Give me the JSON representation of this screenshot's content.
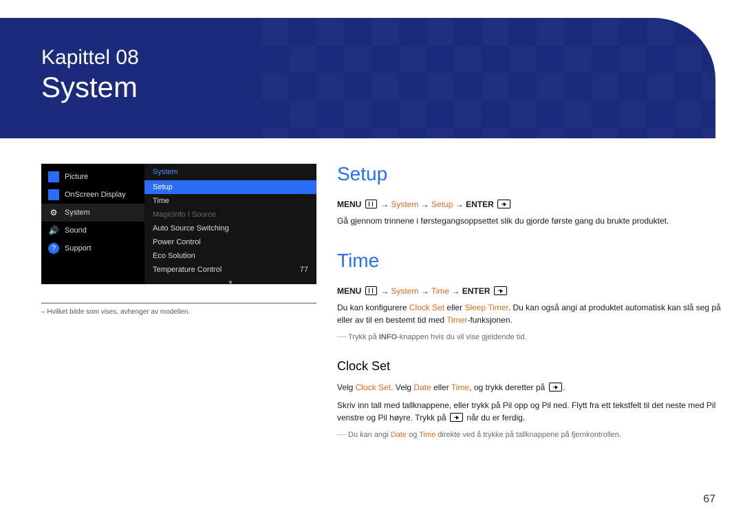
{
  "chapter": {
    "pre": "Kapittel 08",
    "title": "System"
  },
  "page_number": "67",
  "osd": {
    "left": [
      {
        "icon": "picture-icon",
        "label": "Picture"
      },
      {
        "icon": "onscreen-icon",
        "label": "OnScreen Display"
      },
      {
        "icon": "gear-icon",
        "label": "System"
      },
      {
        "icon": "speaker-icon",
        "label": "Sound"
      },
      {
        "icon": "help-icon",
        "label": "Support"
      }
    ],
    "right_header": "System",
    "right": [
      {
        "label": "Setup",
        "value": "",
        "state": "selected"
      },
      {
        "label": "Time",
        "value": ""
      },
      {
        "label": "MagicInfo I Source",
        "value": "",
        "state": "disabled"
      },
      {
        "label": "Auto Source Switching",
        "value": ""
      },
      {
        "label": "Power Control",
        "value": ""
      },
      {
        "label": "Eco Solution",
        "value": ""
      },
      {
        "label": "Temperature Control",
        "value": "77"
      }
    ],
    "footnote_prefix": "–",
    "footnote": "Hvilket bilde som vises, avhenger av modellen."
  },
  "setup": {
    "heading": "Setup",
    "path_menu": "MENU",
    "path_system": "System",
    "path_setup": "Setup",
    "path_enter": "ENTER",
    "body": "Gå gjennom trinnene i førstegangsoppsettet slik du gjorde første gang du brukte produktet."
  },
  "time": {
    "heading": "Time",
    "path_menu": "MENU",
    "path_system": "System",
    "path_time": "Time",
    "path_enter": "ENTER",
    "body_pre1": "Du kan konfigurere ",
    "body_clockset": "Clock Set",
    "body_mid1": " eller ",
    "body_sleeptimer": "Sleep Timer",
    "body_post1": ". Du kan også angi at produktet automatisk kan slå seg på eller av til en bestemt tid med ",
    "body_timer": "Timer",
    "body_post2": "-funksjonen.",
    "hint_pre": "Trykk på ",
    "hint_bold": "INFO",
    "hint_post": "-knappen hvis du vil vise gjeldende tid."
  },
  "clock_set": {
    "heading": "Clock Set",
    "l1_pre": "Velg ",
    "l1_clockset": "Clock Set",
    "l1_mid1": ". Velg ",
    "l1_date": "Date",
    "l1_mid2": " eller ",
    "l1_time": "Time",
    "l1_post": ", og trykk deretter på ",
    "l1_period": ".",
    "l2": "Skriv inn tall med tallknappene, eller trykk på Pil opp og Pil ned. Flytt fra ett tekstfelt til det neste med Pil venstre og Pil høyre. Trykk på ",
    "l2_post": " når du er ferdig.",
    "hint_pre": "Du kan angi ",
    "hint_date": "Date",
    "hint_mid": " og ",
    "hint_time": "Time",
    "hint_post": " direkte ved å trykke på tallknappene på fjernkontrollen."
  }
}
